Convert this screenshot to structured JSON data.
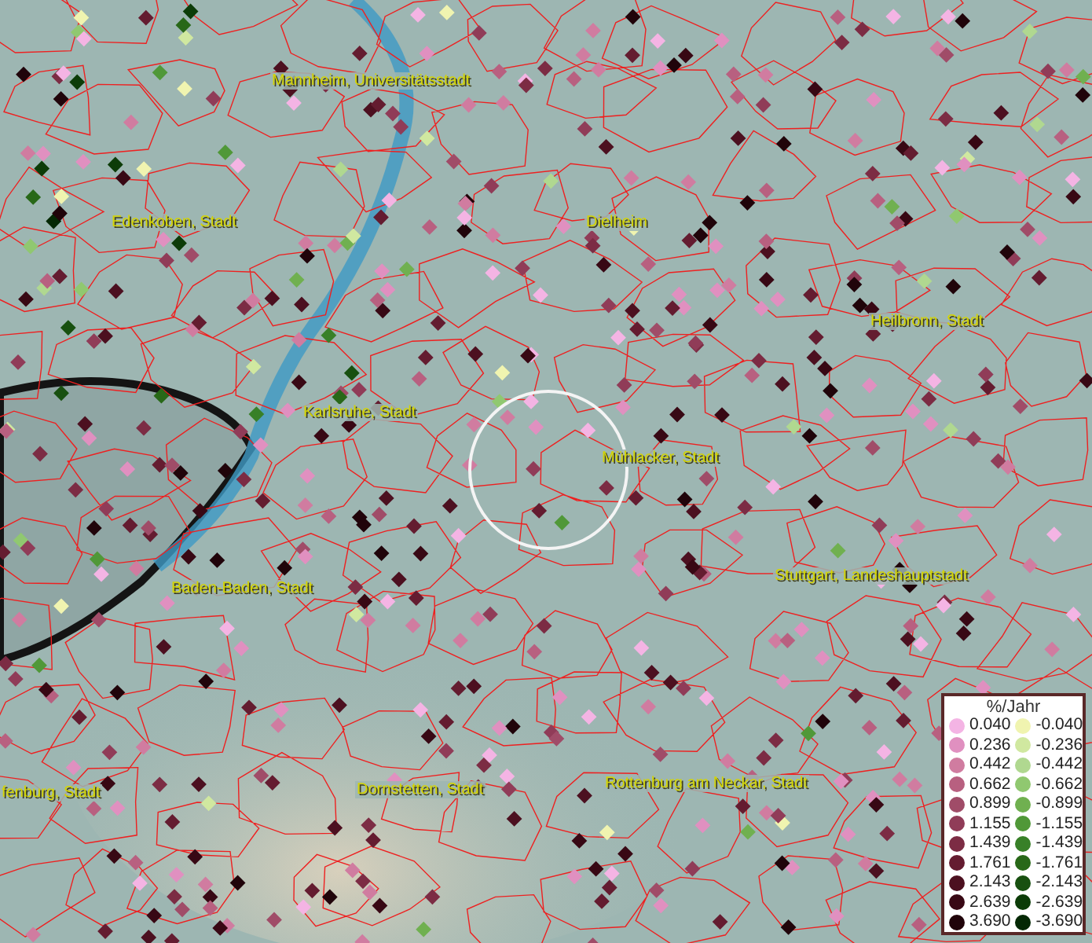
{
  "map": {
    "places": [
      {
        "name": "Mannheim, Universitätsstadt"
      },
      {
        "name": "Edenkoben, Stadt"
      },
      {
        "name": "Dielheim"
      },
      {
        "name": "Heilbronn, Stadt"
      },
      {
        "name": "Karlsruhe, Stadt"
      },
      {
        "name": "Mühlacker, Stadt"
      },
      {
        "name": "Baden-Baden, Stadt"
      },
      {
        "name": "Stuttgart, Landeshauptstadt"
      },
      {
        "name": "fenburg, Stadt"
      },
      {
        "name": "Dornstetten, Stadt"
      },
      {
        "name": "Rottenburg am Neckar, Stadt"
      }
    ]
  },
  "legend": {
    "title": "%/Jahr",
    "positive": [
      {
        "value": "0.040",
        "color": "#f4b4e4"
      },
      {
        "value": "0.236",
        "color": "#e090c0"
      },
      {
        "value": "0.442",
        "color": "#d07ca0"
      },
      {
        "value": "0.662",
        "color": "#b86080"
      },
      {
        "value": "0.899",
        "color": "#a04c68"
      },
      {
        "value": "1.155",
        "color": "#903c58"
      },
      {
        "value": "1.439",
        "color": "#7c2c44"
      },
      {
        "value": "1.761",
        "color": "#641c30"
      },
      {
        "value": "2.143",
        "color": "#4c1020"
      },
      {
        "value": "2.639",
        "color": "#380814"
      },
      {
        "value": "3.690",
        "color": "#20040a"
      }
    ],
    "negative": [
      {
        "value": "-0.040",
        "color": "#f0f4b0"
      },
      {
        "value": "-0.236",
        "color": "#d0e8a0"
      },
      {
        "value": "-0.442",
        "color": "#b0d890"
      },
      {
        "value": "-0.662",
        "color": "#90c870"
      },
      {
        "value": "-0.899",
        "color": "#70b050"
      },
      {
        "value": "-1.155",
        "color": "#509838"
      },
      {
        "value": "-1.439",
        "color": "#388028"
      },
      {
        "value": "-1.761",
        "color": "#286818"
      },
      {
        "value": "-2.143",
        "color": "#185010"
      },
      {
        "value": "-2.639",
        "color": "#0c3c08"
      },
      {
        "value": "-3.690",
        "color": "#042804"
      }
    ]
  }
}
